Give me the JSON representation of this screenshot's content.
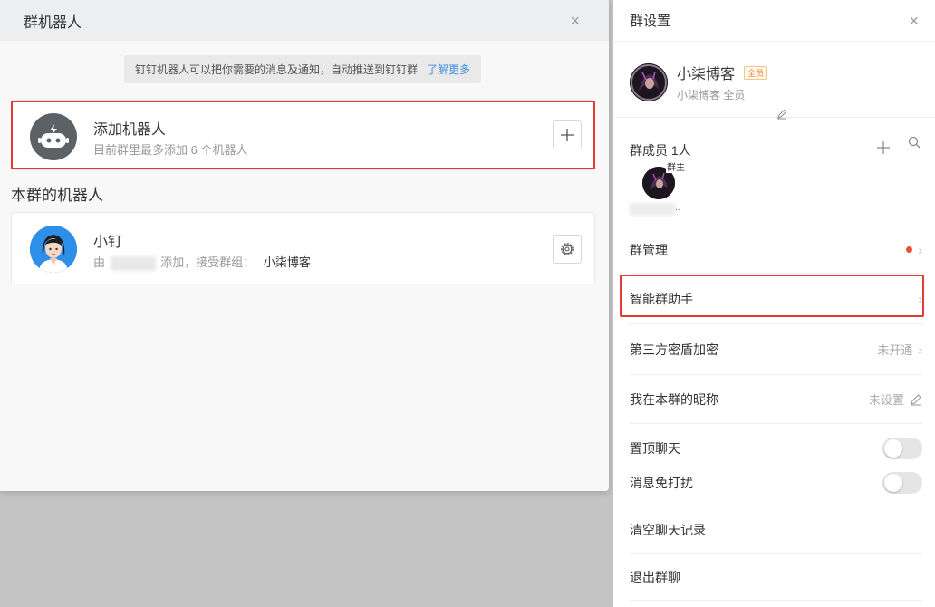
{
  "dialog": {
    "title": "群机器人",
    "close_icon": "×",
    "notice_text": "钉钉机器人可以把你需要的消息及通知，自动推送到钉钉群",
    "notice_link": "了解更多",
    "add_robot": {
      "title": "添加机器人",
      "subtitle": "目前群里最多添加 6 个机器人"
    },
    "section_title": "本群的机器人",
    "robot": {
      "name": "小钉",
      "desc_prefix": "由",
      "desc_middle": "添加，接受群组：",
      "group_name": "小柒博客"
    }
  },
  "panel": {
    "title": "群设置",
    "close_icon": "×",
    "group_name": "小柒博客",
    "badge": "全员",
    "group_sub": "小柒博客 全员",
    "members_title": "群成员 1人",
    "owner_tag": "群主",
    "member_ellipsis": "..",
    "rows": {
      "manage": "群管理",
      "assistant": "智能群助手",
      "encrypt": "第三方密盾加密",
      "encrypt_status": "未开通",
      "nickname": "我在本群的昵称",
      "nickname_status": "未设置",
      "pin": "置顶聊天",
      "mute": "消息免打扰",
      "clear": "清空聊天记录",
      "exit": "退出群聊"
    },
    "toggles": {
      "pin": "off",
      "mute": "off"
    }
  },
  "colors": {
    "highlight": "#e53935",
    "link": "#3d8fe0",
    "badge": "#f08c2e",
    "alert_dot": "#e8513c"
  },
  "icons": [
    "close-icon",
    "robot-icon",
    "plus-icon",
    "gear-icon",
    "edit-icon",
    "search-icon",
    "chevron-right-icon"
  ]
}
